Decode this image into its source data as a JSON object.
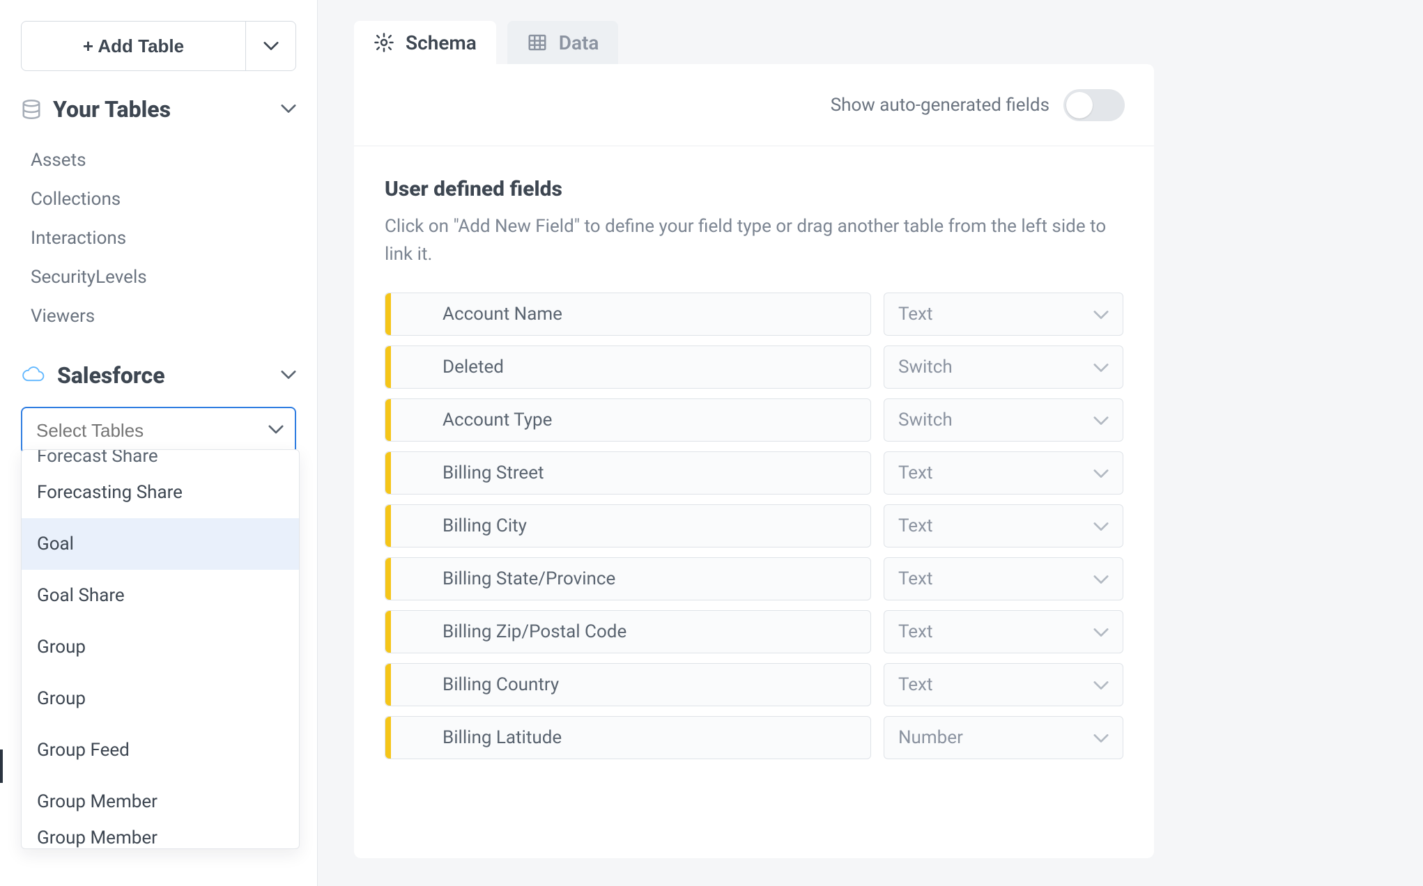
{
  "sidebar": {
    "add_table_label": "+ Add Table",
    "your_tables_label": "Your Tables",
    "tables": [
      {
        "label": "Assets"
      },
      {
        "label": "Collections"
      },
      {
        "label": "Interactions"
      },
      {
        "label": "SecurityLevels"
      },
      {
        "label": "Viewers"
      }
    ],
    "salesforce_label": "Salesforce",
    "select_placeholder": "Select Tables",
    "dropdown_peek_top": "Forecast Share",
    "dropdown_options": [
      {
        "label": "Forecasting Share",
        "highlight": false
      },
      {
        "label": "Goal",
        "highlight": true
      },
      {
        "label": "Goal Share",
        "highlight": false
      },
      {
        "label": "Group",
        "highlight": false
      },
      {
        "label": "Group",
        "highlight": false
      },
      {
        "label": "Group Feed",
        "highlight": false
      },
      {
        "label": "Group Member",
        "highlight": false
      }
    ],
    "dropdown_peek_bottom": "Group Member"
  },
  "main": {
    "tabs": {
      "schema": "Schema",
      "data": "Data"
    },
    "toggle_label": "Show auto-generated fields",
    "udf_title": "User defined fields",
    "udf_desc": "Click on \"Add New Field\" to define your field type or drag another table from the left side to link it.",
    "fields": [
      {
        "name": "Account Name",
        "type": "Text"
      },
      {
        "name": "Deleted",
        "type": "Switch"
      },
      {
        "name": "Account Type",
        "type": "Switch"
      },
      {
        "name": "Billing Street",
        "type": "Text"
      },
      {
        "name": "Billing City",
        "type": "Text"
      },
      {
        "name": "Billing State/Province",
        "type": "Text"
      },
      {
        "name": "Billing Zip/Postal Code",
        "type": "Text"
      },
      {
        "name": "Billing Country",
        "type": "Text"
      },
      {
        "name": "Billing Latitude",
        "type": "Number"
      }
    ]
  }
}
